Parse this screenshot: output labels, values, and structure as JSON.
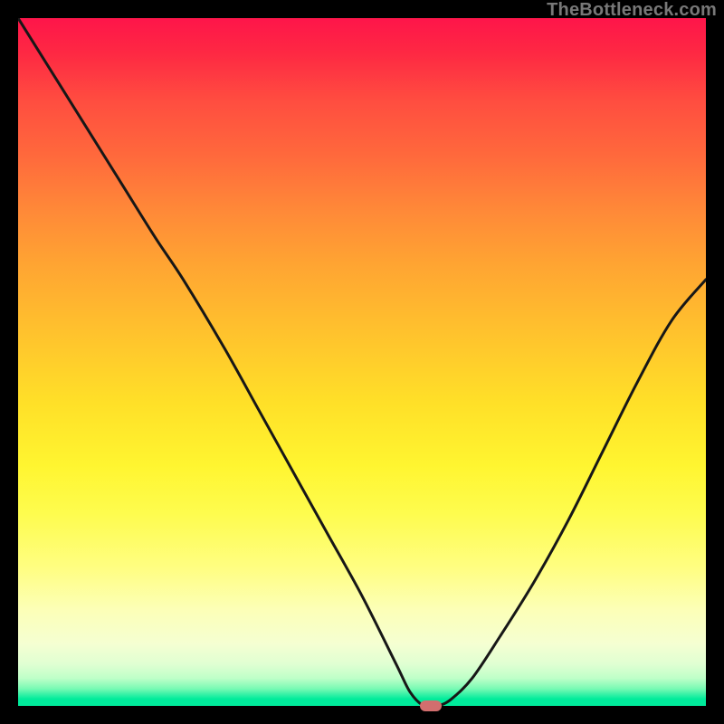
{
  "watermark": "TheBottleneck.com",
  "colors": {
    "marker": "rgb(210, 110, 110)",
    "curve": "rgb(23, 23, 23)"
  },
  "chart_data": {
    "type": "line",
    "title": "",
    "xlabel": "",
    "ylabel": "",
    "xlim": [
      0,
      100
    ],
    "ylim": [
      0,
      100
    ],
    "grid": false,
    "legend": false,
    "series": [
      {
        "name": "bottleneck-curve",
        "x": [
          0,
          5,
          10,
          15,
          20,
          24,
          30,
          35,
          40,
          45,
          50,
          55,
          57,
          59,
          61,
          63,
          66,
          70,
          75,
          80,
          85,
          90,
          95,
          100
        ],
        "y": [
          100,
          92,
          84,
          76,
          68,
          62,
          52,
          43,
          34,
          25,
          16,
          6,
          2,
          0,
          0,
          1,
          4,
          10,
          18,
          27,
          37,
          47,
          56,
          62
        ]
      }
    ],
    "marker": {
      "x": 60,
      "y": 0
    }
  }
}
